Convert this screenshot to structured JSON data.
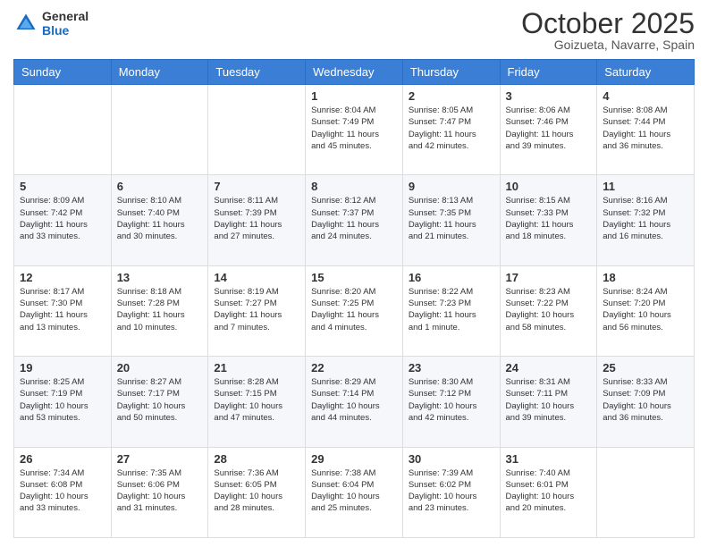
{
  "header": {
    "logo_general": "General",
    "logo_blue": "Blue",
    "month_title": "October 2025",
    "location": "Goizueta, Navarre, Spain"
  },
  "days_of_week": [
    "Sunday",
    "Monday",
    "Tuesday",
    "Wednesday",
    "Thursday",
    "Friday",
    "Saturday"
  ],
  "weeks": [
    [
      {
        "day": "",
        "info": ""
      },
      {
        "day": "",
        "info": ""
      },
      {
        "day": "",
        "info": ""
      },
      {
        "day": "1",
        "info": "Sunrise: 8:04 AM\nSunset: 7:49 PM\nDaylight: 11 hours\nand 45 minutes."
      },
      {
        "day": "2",
        "info": "Sunrise: 8:05 AM\nSunset: 7:47 PM\nDaylight: 11 hours\nand 42 minutes."
      },
      {
        "day": "3",
        "info": "Sunrise: 8:06 AM\nSunset: 7:46 PM\nDaylight: 11 hours\nand 39 minutes."
      },
      {
        "day": "4",
        "info": "Sunrise: 8:08 AM\nSunset: 7:44 PM\nDaylight: 11 hours\nand 36 minutes."
      }
    ],
    [
      {
        "day": "5",
        "info": "Sunrise: 8:09 AM\nSunset: 7:42 PM\nDaylight: 11 hours\nand 33 minutes."
      },
      {
        "day": "6",
        "info": "Sunrise: 8:10 AM\nSunset: 7:40 PM\nDaylight: 11 hours\nand 30 minutes."
      },
      {
        "day": "7",
        "info": "Sunrise: 8:11 AM\nSunset: 7:39 PM\nDaylight: 11 hours\nand 27 minutes."
      },
      {
        "day": "8",
        "info": "Sunrise: 8:12 AM\nSunset: 7:37 PM\nDaylight: 11 hours\nand 24 minutes."
      },
      {
        "day": "9",
        "info": "Sunrise: 8:13 AM\nSunset: 7:35 PM\nDaylight: 11 hours\nand 21 minutes."
      },
      {
        "day": "10",
        "info": "Sunrise: 8:15 AM\nSunset: 7:33 PM\nDaylight: 11 hours\nand 18 minutes."
      },
      {
        "day": "11",
        "info": "Sunrise: 8:16 AM\nSunset: 7:32 PM\nDaylight: 11 hours\nand 16 minutes."
      }
    ],
    [
      {
        "day": "12",
        "info": "Sunrise: 8:17 AM\nSunset: 7:30 PM\nDaylight: 11 hours\nand 13 minutes."
      },
      {
        "day": "13",
        "info": "Sunrise: 8:18 AM\nSunset: 7:28 PM\nDaylight: 11 hours\nand 10 minutes."
      },
      {
        "day": "14",
        "info": "Sunrise: 8:19 AM\nSunset: 7:27 PM\nDaylight: 11 hours\nand 7 minutes."
      },
      {
        "day": "15",
        "info": "Sunrise: 8:20 AM\nSunset: 7:25 PM\nDaylight: 11 hours\nand 4 minutes."
      },
      {
        "day": "16",
        "info": "Sunrise: 8:22 AM\nSunset: 7:23 PM\nDaylight: 11 hours\nand 1 minute."
      },
      {
        "day": "17",
        "info": "Sunrise: 8:23 AM\nSunset: 7:22 PM\nDaylight: 10 hours\nand 58 minutes."
      },
      {
        "day": "18",
        "info": "Sunrise: 8:24 AM\nSunset: 7:20 PM\nDaylight: 10 hours\nand 56 minutes."
      }
    ],
    [
      {
        "day": "19",
        "info": "Sunrise: 8:25 AM\nSunset: 7:19 PM\nDaylight: 10 hours\nand 53 minutes."
      },
      {
        "day": "20",
        "info": "Sunrise: 8:27 AM\nSunset: 7:17 PM\nDaylight: 10 hours\nand 50 minutes."
      },
      {
        "day": "21",
        "info": "Sunrise: 8:28 AM\nSunset: 7:15 PM\nDaylight: 10 hours\nand 47 minutes."
      },
      {
        "day": "22",
        "info": "Sunrise: 8:29 AM\nSunset: 7:14 PM\nDaylight: 10 hours\nand 44 minutes."
      },
      {
        "day": "23",
        "info": "Sunrise: 8:30 AM\nSunset: 7:12 PM\nDaylight: 10 hours\nand 42 minutes."
      },
      {
        "day": "24",
        "info": "Sunrise: 8:31 AM\nSunset: 7:11 PM\nDaylight: 10 hours\nand 39 minutes."
      },
      {
        "day": "25",
        "info": "Sunrise: 8:33 AM\nSunset: 7:09 PM\nDaylight: 10 hours\nand 36 minutes."
      }
    ],
    [
      {
        "day": "26",
        "info": "Sunrise: 7:34 AM\nSunset: 6:08 PM\nDaylight: 10 hours\nand 33 minutes."
      },
      {
        "day": "27",
        "info": "Sunrise: 7:35 AM\nSunset: 6:06 PM\nDaylight: 10 hours\nand 31 minutes."
      },
      {
        "day": "28",
        "info": "Sunrise: 7:36 AM\nSunset: 6:05 PM\nDaylight: 10 hours\nand 28 minutes."
      },
      {
        "day": "29",
        "info": "Sunrise: 7:38 AM\nSunset: 6:04 PM\nDaylight: 10 hours\nand 25 minutes."
      },
      {
        "day": "30",
        "info": "Sunrise: 7:39 AM\nSunset: 6:02 PM\nDaylight: 10 hours\nand 23 minutes."
      },
      {
        "day": "31",
        "info": "Sunrise: 7:40 AM\nSunset: 6:01 PM\nDaylight: 10 hours\nand 20 minutes."
      },
      {
        "day": "",
        "info": ""
      }
    ]
  ]
}
